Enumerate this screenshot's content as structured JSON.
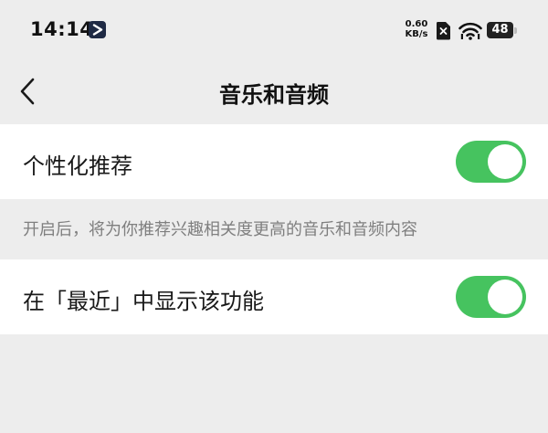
{
  "status_bar": {
    "time": "14:14",
    "net_speed_value": "0.60",
    "net_speed_unit": "KB/s",
    "battery_level": "48"
  },
  "header": {
    "title": "音乐和音频"
  },
  "settings": {
    "personalized_label": "个性化推荐",
    "personalized_enabled": true,
    "personalized_hint": "开启后，将为你推荐兴趣相关度更高的音乐和音频内容",
    "show_in_recent_label": "在「最近」中显示该功能",
    "show_in_recent_enabled": true
  },
  "colors": {
    "toggle_on": "#46c35f",
    "background": "#ededed",
    "row_background": "#ffffff"
  },
  "icons": {
    "back": "chevron-left-icon",
    "app": "play-icon",
    "sim": "no-sim-icon",
    "wifi": "wifi-icon",
    "battery": "battery-icon"
  }
}
